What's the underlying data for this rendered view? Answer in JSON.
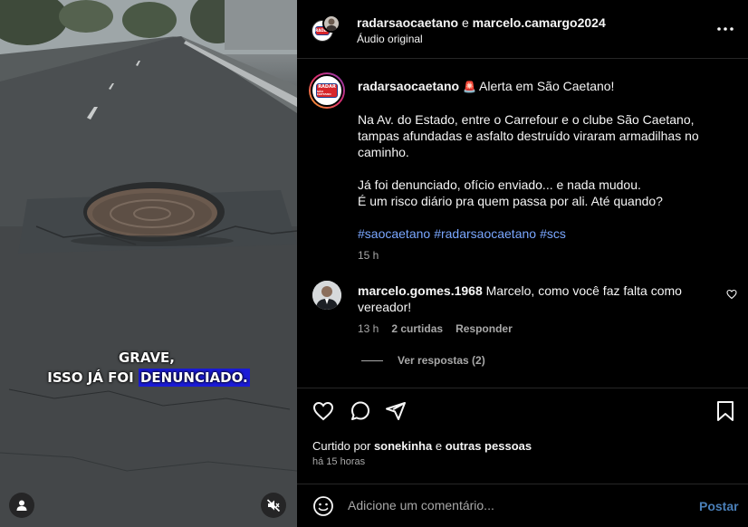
{
  "video": {
    "caption_line1": "GRAVE,",
    "caption_line2_prefix": "ISSO JÁ FOI ",
    "caption_line2_highlight": "DENUNCIADO."
  },
  "header": {
    "author1": "radarsaocaetano",
    "joiner": "e",
    "author2": "marcelo.camargo2024",
    "audio": "Áudio original"
  },
  "logo": {
    "line1": "RADAR",
    "line2": "SÃO CAETANO"
  },
  "post": {
    "username": "radarsaocaetano",
    "alert_emoji": "🚨",
    "headline": "Alerta em São Caetano!",
    "paragraph1": "Na Av. do Estado, entre o Carrefour e o clube São Caetano, tampas afundadas e asfalto destruído viraram armadilhas no caminho.",
    "paragraph2_line1": "Já foi denunciado, ofício enviado... e nada mudou.",
    "paragraph2_line2": "É um risco diário pra quem passa por ali. Até quando?",
    "hashtags": [
      "#saocaetano",
      "#radarsaocaetano",
      "#scs"
    ],
    "time": "15 h"
  },
  "comment": {
    "username": "marcelo.gomes.1968",
    "text": "Marcelo, como você faz falta como vereador!",
    "time": "13 h",
    "likes": "2 curtidas",
    "reply": "Responder",
    "view_replies": "Ver respostas (2)"
  },
  "footer": {
    "liked_by_prefix": "Curtido por",
    "liked_by_user": "sonekinha",
    "liked_by_joiner": "e",
    "liked_by_others": "outras pessoas",
    "time_ago": "há 15 horas",
    "comment_placeholder": "Adicione um comentário...",
    "post_label": "Postar"
  },
  "colors": {
    "background": "#000000",
    "hashtag": "#7aa7ff",
    "muted": "#a8a8a8",
    "post_button": "#4a7fb8",
    "caption_highlight": "#1b1bd6"
  }
}
